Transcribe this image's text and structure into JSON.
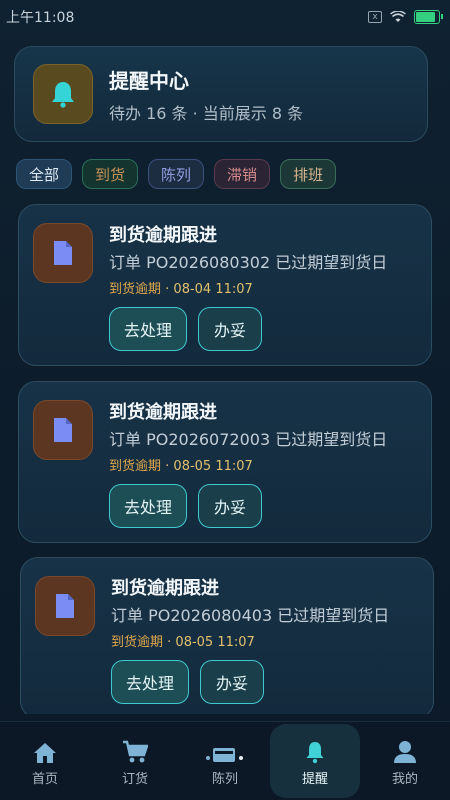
{
  "status_bar": {
    "time": "上午11:08",
    "close_glyph": "x"
  },
  "header": {
    "icon": "bell-icon",
    "title": "提醒中心",
    "subtitle": "待办 16 条 · 当前展示 8 条"
  },
  "filters": [
    {
      "label": "全部"
    },
    {
      "label": "到货"
    },
    {
      "label": "陈列"
    },
    {
      "label": "滞销"
    },
    {
      "label": "排班"
    }
  ],
  "cards": [
    {
      "icon": "document-icon",
      "title": "到货逾期跟进",
      "desc": "订单 PO2026080302 已过期望到货日",
      "meta_tag": "到货逾期",
      "meta_sep": " · ",
      "meta_time": "08-04 11:07",
      "primary": "去处理",
      "secondary": "办妥"
    },
    {
      "icon": "document-icon",
      "title": "到货逾期跟进",
      "desc": "订单 PO2026072003 已过期望到货日",
      "meta_tag": "到货逾期",
      "meta_sep": " · ",
      "meta_time": "08-05 11:07",
      "primary": "去处理",
      "secondary": "办妥"
    },
    {
      "icon": "document-icon",
      "title": "到货逾期跟进",
      "desc": "订单 PO2026080403 已过期望到货日",
      "meta_tag": "到货逾期",
      "meta_sep": " · ",
      "meta_time": "08-05 11:07",
      "primary": "去处理",
      "secondary": "办妥"
    }
  ],
  "tabbar": [
    {
      "label": "首页",
      "icon": "home-icon"
    },
    {
      "label": "订货",
      "icon": "cart-icon"
    },
    {
      "label": "陈列",
      "icon": "display-icon"
    },
    {
      "label": "提醒",
      "icon": "bell-icon",
      "active": true
    },
    {
      "label": "我的",
      "icon": "user-icon"
    }
  ],
  "colors": {
    "accent": "#3fc9cf",
    "bell": "#35d4d6",
    "doc": "#7b8cf5"
  }
}
